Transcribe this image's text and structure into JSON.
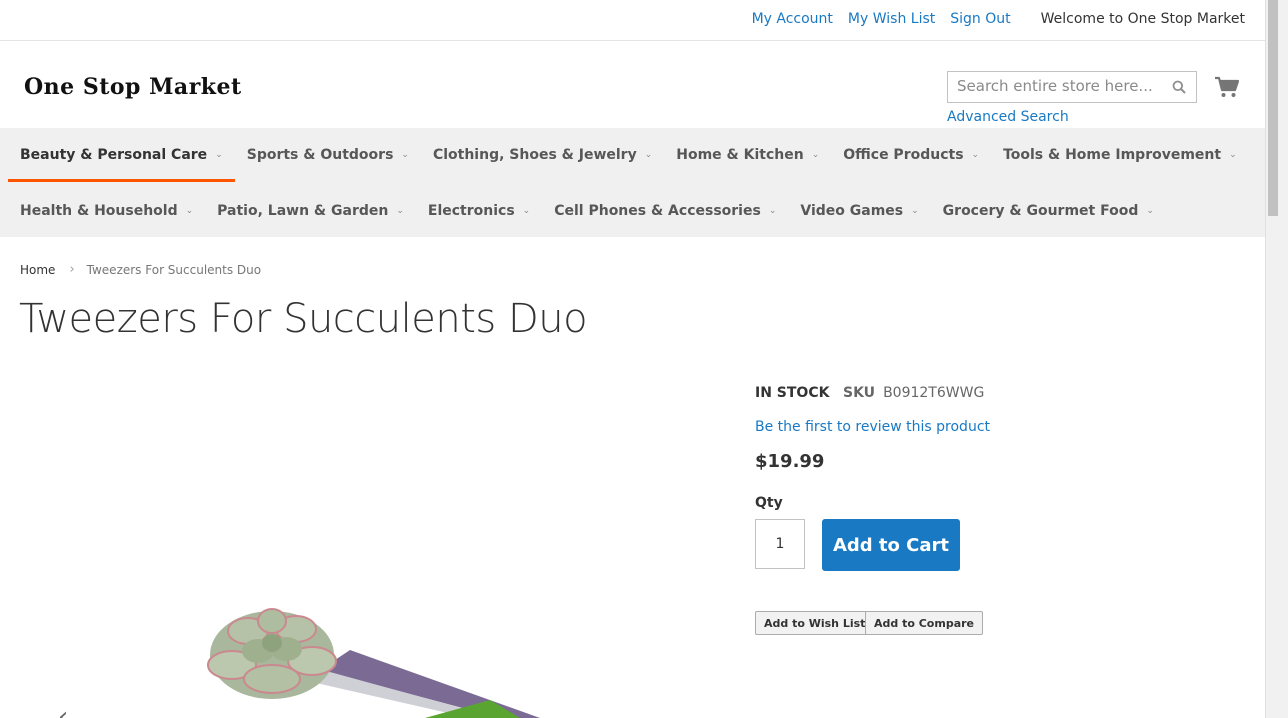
{
  "header": {
    "links": [
      "My Account",
      "My Wish List",
      "Sign Out"
    ],
    "welcome": "Welcome to One Stop Market"
  },
  "logo": {
    "text": "One Stop Market"
  },
  "search": {
    "placeholder": "Search entire store here...",
    "value": "",
    "advanced_label": "Advanced Search"
  },
  "nav": {
    "row1": [
      {
        "label": "Beauty & Personal Care",
        "active": true
      },
      {
        "label": "Sports & Outdoors"
      },
      {
        "label": "Clothing, Shoes & Jewelry"
      },
      {
        "label": "Home & Kitchen"
      },
      {
        "label": "Office Products"
      },
      {
        "label": "Tools & Home Improvement"
      }
    ],
    "row2": [
      {
        "label": "Health & Household"
      },
      {
        "label": "Patio, Lawn & Garden"
      },
      {
        "label": "Electronics"
      },
      {
        "label": "Cell Phones & Accessories"
      },
      {
        "label": "Video Games"
      },
      {
        "label": "Grocery & Gourmet Food"
      }
    ]
  },
  "breadcrumb": {
    "home": "Home",
    "current": "Tweezers For Succulents Duo"
  },
  "product": {
    "title": "Tweezers For Succulents Duo",
    "stock": "IN STOCK",
    "sku_label": "SKU",
    "sku": "B0912T6WWG",
    "review_link": "Be the first to review this product",
    "price": "$19.99",
    "qty_label": "Qty",
    "qty": "1",
    "add_to_cart": "Add to Cart",
    "add_to_wishlist": "Add to Wish List",
    "add_to_compare": "Add to Compare"
  },
  "colors": {
    "link": "#1979c3",
    "primary_button": "#1979c3",
    "nav_active_underline": "#ff5501",
    "nav_background": "#f0f0f0"
  },
  "icons": {
    "search": "search-icon",
    "cart": "cart-icon",
    "gallery_prev": "chevron-left-icon"
  }
}
